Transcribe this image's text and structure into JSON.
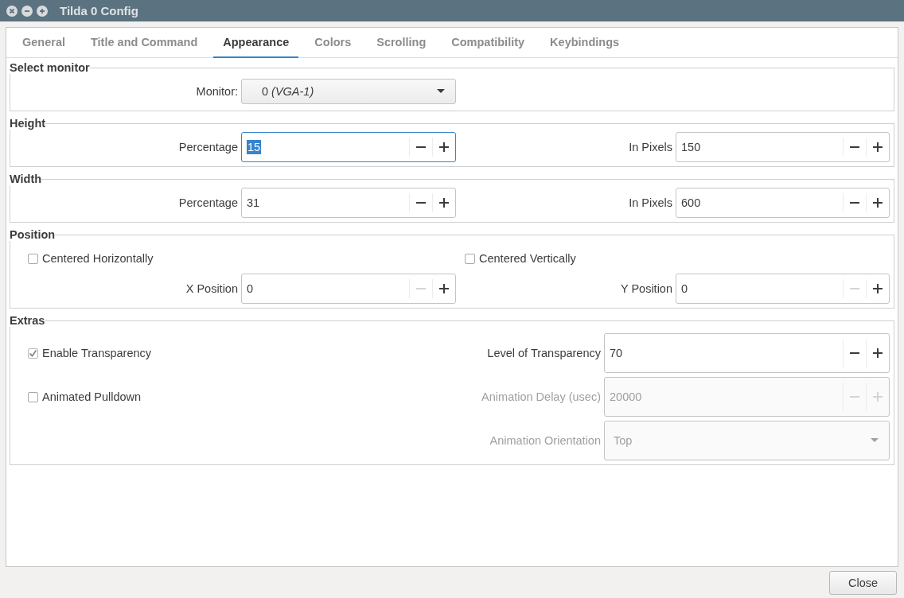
{
  "window": {
    "title": "Tilda 0 Config"
  },
  "tabs": [
    {
      "label": "General",
      "selected": false
    },
    {
      "label": "Title and Command",
      "selected": false
    },
    {
      "label": "Appearance",
      "selected": true
    },
    {
      "label": "Colors",
      "selected": false
    },
    {
      "label": "Scrolling",
      "selected": false
    },
    {
      "label": "Compatibility",
      "selected": false
    },
    {
      "label": "Keybindings",
      "selected": false
    }
  ],
  "sections": [
    {
      "title": "Select monitor",
      "rows": [
        {
          "left": {
            "kind": "combo",
            "label": "Monitor:",
            "value": "0   *(VGA-1)*",
            "disabled": false
          }
        }
      ]
    },
    {
      "title": "Height",
      "rows": [
        {
          "left": {
            "kind": "spin",
            "label": "Percentage",
            "value": "15",
            "focused": true,
            "disabled": false,
            "minus_disabled": false
          },
          "right": {
            "kind": "spin",
            "label": "In Pixels",
            "value": "150",
            "focused": false,
            "disabled": false,
            "minus_disabled": false
          }
        }
      ]
    },
    {
      "title": "Width",
      "rows": [
        {
          "left": {
            "kind": "spin",
            "label": "Percentage",
            "value": "31",
            "focused": false,
            "disabled": false,
            "minus_disabled": false
          },
          "right": {
            "kind": "spin",
            "label": "In Pixels",
            "value": "600",
            "focused": false,
            "disabled": false,
            "minus_disabled": false
          }
        }
      ]
    },
    {
      "title": "Position",
      "rows": [
        {
          "left": {
            "kind": "check",
            "label": "Centered Horizontally",
            "checked": false
          },
          "right": {
            "kind": "check",
            "label": "Centered Vertically",
            "checked": false
          }
        },
        {
          "left": {
            "kind": "spin",
            "label": "X Position",
            "value": "0",
            "focused": false,
            "disabled": false,
            "minus_disabled": true
          },
          "right": {
            "kind": "spin",
            "label": "Y Position",
            "value": "0",
            "focused": false,
            "disabled": false,
            "minus_disabled": true
          }
        }
      ]
    },
    {
      "title": "Extras",
      "rows": [
        {
          "left": {
            "kind": "check",
            "label": "Enable Transparency",
            "checked": true
          },
          "right": {
            "kind": "spin",
            "label": "Level of Transparency",
            "value": "70",
            "focused": false,
            "disabled": false,
            "minus_disabled": false
          }
        },
        {
          "left": {
            "kind": "check",
            "label": "Animated Pulldown",
            "checked": false
          },
          "right": {
            "kind": "spin",
            "label": "Animation Delay (usec)",
            "value": "20000",
            "focused": false,
            "disabled": true,
            "minus_disabled": true
          }
        },
        {
          "right": {
            "kind": "combo",
            "label": "Animation Orientation",
            "value": "Top",
            "disabled": true
          }
        }
      ]
    }
  ],
  "buttons": [
    "Close"
  ]
}
